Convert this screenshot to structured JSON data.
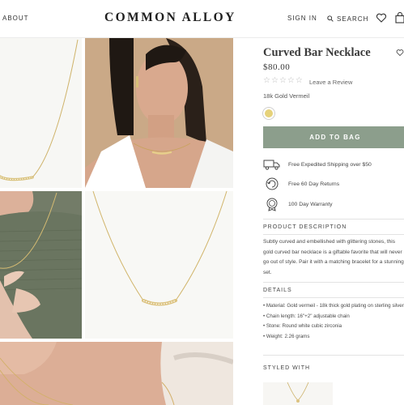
{
  "header": {
    "nav_about": "ABOUT",
    "logo": "COMMON ALLOY",
    "sign_in": "SIGN IN",
    "search": "SEARCH",
    "icons": [
      "search-icon",
      "heart-icon",
      "shopping-bag-icon"
    ]
  },
  "gallery": {
    "images": [
      {
        "name": "necklace-closeup-white"
      },
      {
        "name": "model-wearing-necklace"
      },
      {
        "name": "model-hand-green-top"
      },
      {
        "name": "necklace-full-white"
      },
      {
        "name": "model-neck-closeup"
      }
    ]
  },
  "product": {
    "title": "Curved Bar Necklace",
    "price": "$80.00",
    "rating_stars": 0,
    "review_link": "Leave a Review",
    "material": "18k Gold Vermeil",
    "swatch_color": "#e6d27a",
    "add_to_bag": "ADD TO BAG",
    "accent_color": "#8c9e8c"
  },
  "perks": [
    {
      "icon": "truck-icon",
      "text": "Free Expedited Shipping over $50"
    },
    {
      "icon": "return-icon",
      "text": "Free 60 Day Returns"
    },
    {
      "icon": "warranty-badge-icon",
      "text": "100 Day Warranty"
    }
  ],
  "sections": {
    "description_title": "PRODUCT DESCRIPTION",
    "description_toggle": "-",
    "description_text": "Subtly curved and embellished with glittering stones, this gold curved bar necklace is a giftable favorite that will never go out of style. Pair it with a matching bracelet for a stunning set.",
    "details_title": "DETAILS",
    "details_toggle": "-",
    "details": [
      "• Material: Gold vermeil - 18k thick gold plating on sterling silver",
      "• Chain length: 16\"+2\" adjustable chain",
      "• Stone: Round white cubic zirconia",
      "• Weight: 2.26 grams"
    ],
    "styled_with_title": "STYLED WITH"
  }
}
